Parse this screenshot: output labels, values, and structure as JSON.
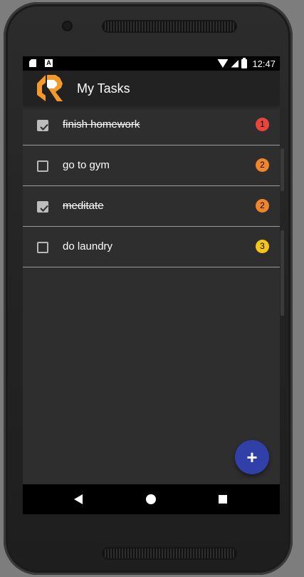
{
  "status_bar": {
    "time": "12:47",
    "left_icons": [
      "sd-card-icon",
      "a-notification-icon"
    ],
    "right_icons": [
      "wifi-icon",
      "signal-icon",
      "battery-charging-icon"
    ],
    "a_glyph": "A"
  },
  "app_bar": {
    "title": "My Tasks",
    "logo_colors": {
      "orange": "#f39a2b",
      "white": "#ffffff"
    }
  },
  "tasks": [
    {
      "label": "finish homework",
      "done": true,
      "priority": "1",
      "priority_color": "#e8453c"
    },
    {
      "label": "go to gym",
      "done": false,
      "priority": "2",
      "priority_color": "#f0852a"
    },
    {
      "label": "meditate",
      "done": true,
      "priority": "2",
      "priority_color": "#f0852a"
    },
    {
      "label": "do laundry",
      "done": false,
      "priority": "3",
      "priority_color": "#f5c518"
    }
  ],
  "fab": {
    "label": "+",
    "color": "#3040a8"
  },
  "nav_bar": {
    "icons": [
      "back-icon",
      "home-icon",
      "recents-icon"
    ]
  }
}
